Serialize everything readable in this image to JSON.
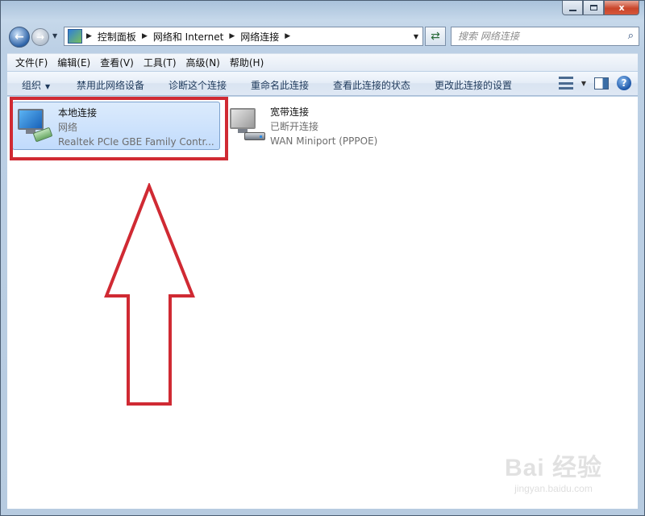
{
  "window": {
    "minimize_label": "",
    "maximize_label": "",
    "close_label": "x"
  },
  "navigation": {
    "back_icon": "back-arrow-icon",
    "forward_icon": "forward-arrow-icon",
    "breadcrumbs": [
      "控制面板",
      "网络和 Internet",
      "网络连接"
    ],
    "search_placeholder": "搜索 网络连接"
  },
  "menubar": {
    "items": [
      "文件(F)",
      "编辑(E)",
      "查看(V)",
      "工具(T)",
      "高级(N)",
      "帮助(H)"
    ]
  },
  "commandbar": {
    "organize": "组织",
    "disable": "禁用此网络设备",
    "diagnose": "诊断这个连接",
    "rename": "重命名此连接",
    "view_status": "查看此连接的状态",
    "change_settings": "更改此连接的设置"
  },
  "connections": [
    {
      "name": "本地连接",
      "status": "网络",
      "device": "Realtek PCIe GBE Family Contr...",
      "selected": true
    },
    {
      "name": "宽带连接",
      "status": "已断开连接",
      "device": "WAN Miniport (PPPOE)",
      "selected": false
    }
  ],
  "watermark": {
    "brand": "Bai 经验",
    "url": "jingyan.baidu.com"
  },
  "colors": {
    "annotation_red": "#d02a33",
    "selection_bg": "#c1dbfc"
  }
}
